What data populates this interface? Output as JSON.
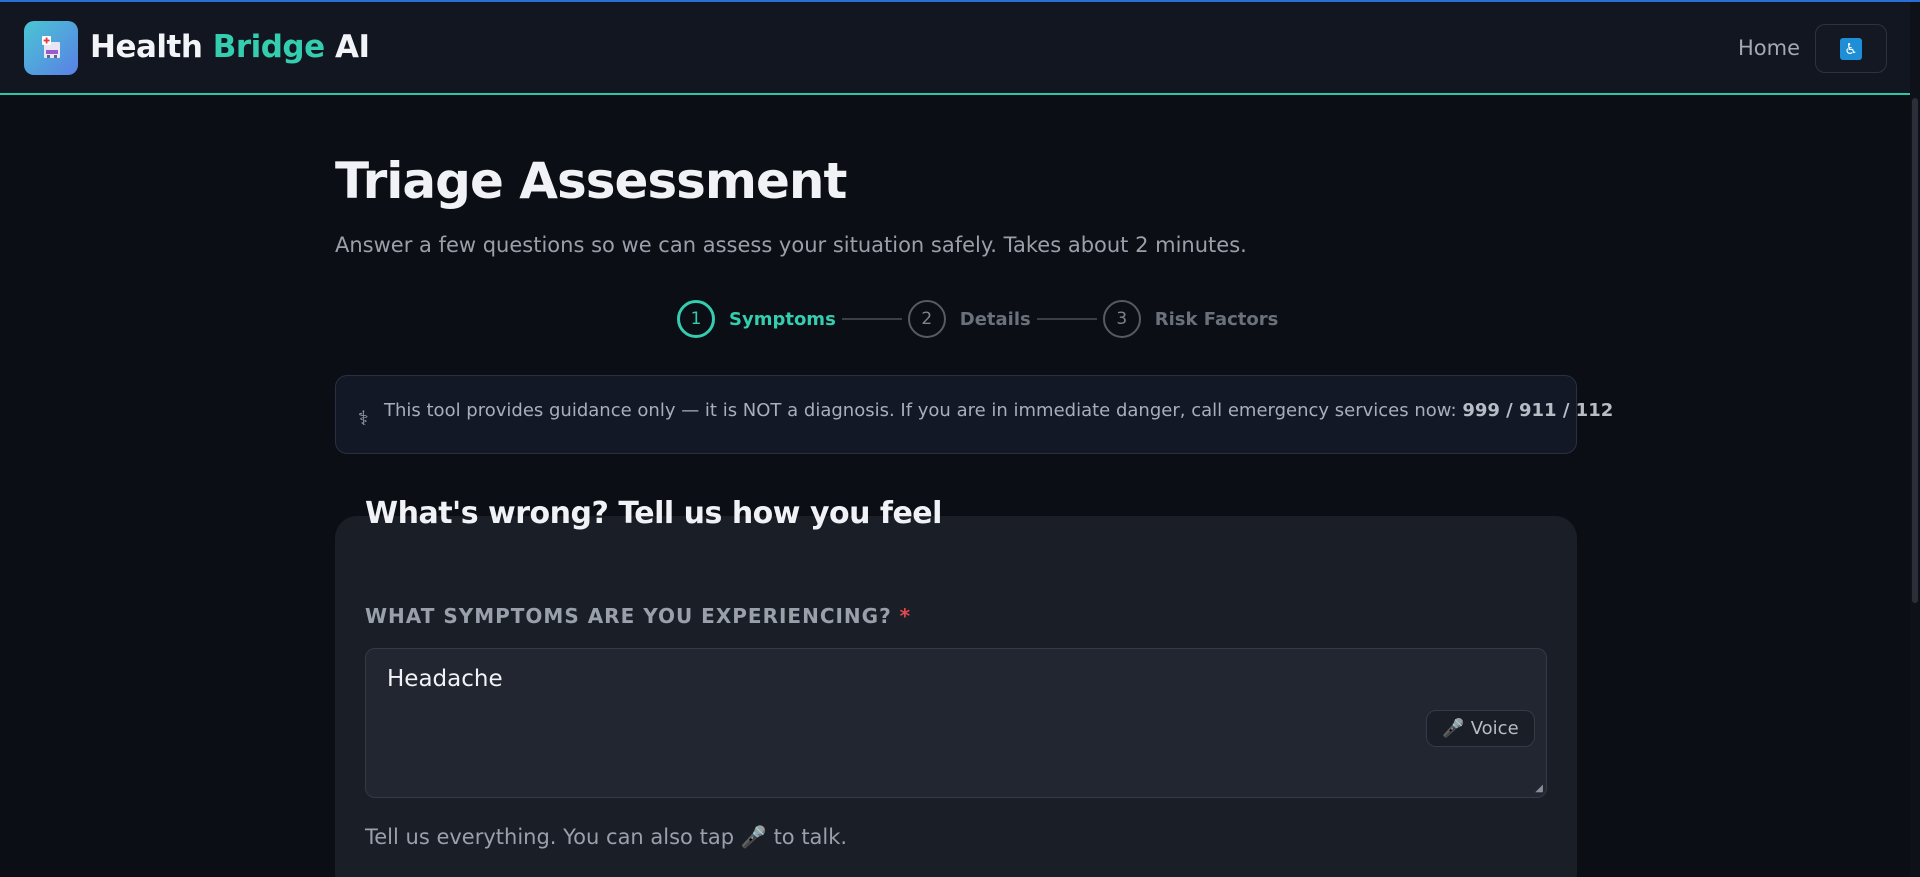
{
  "header": {
    "brand_part1": "Health",
    "brand_part2": "Bridge",
    "brand_part3": "AI",
    "home_link": "Home",
    "accessibility_icon": "wheelchair-icon",
    "logo_icon": "hospital-icon"
  },
  "page": {
    "title": "Triage Assessment",
    "subtitle": "Answer a few questions so we can assess your situation safely. Takes about 2 minutes."
  },
  "stepper": {
    "steps": [
      {
        "number": "1",
        "label": "Symptoms",
        "active": true
      },
      {
        "number": "2",
        "label": "Details",
        "active": false
      },
      {
        "number": "3",
        "label": "Risk Factors",
        "active": false
      }
    ]
  },
  "disclaimer": {
    "icon": "caduceus-icon",
    "text": "This tool provides guidance only — it is NOT a diagnosis. If you are in immediate danger, call emergency services now: ",
    "numbers": "999 / 911 / 112"
  },
  "form": {
    "section_title": "What's wrong? Tell us how you feel",
    "symptoms_label": "WHAT SYMPTOMS ARE YOU EXPERIENCING?",
    "required_marker": "*",
    "symptoms_value": "Headache",
    "voice_button": "Voice",
    "voice_icon": "microphone-icon",
    "hint_before": "Tell us everything. You can also tap",
    "hint_after": "to talk."
  },
  "colors": {
    "accent": "#35cdb0",
    "background": "#0b0e14",
    "required": "#e5484d"
  }
}
